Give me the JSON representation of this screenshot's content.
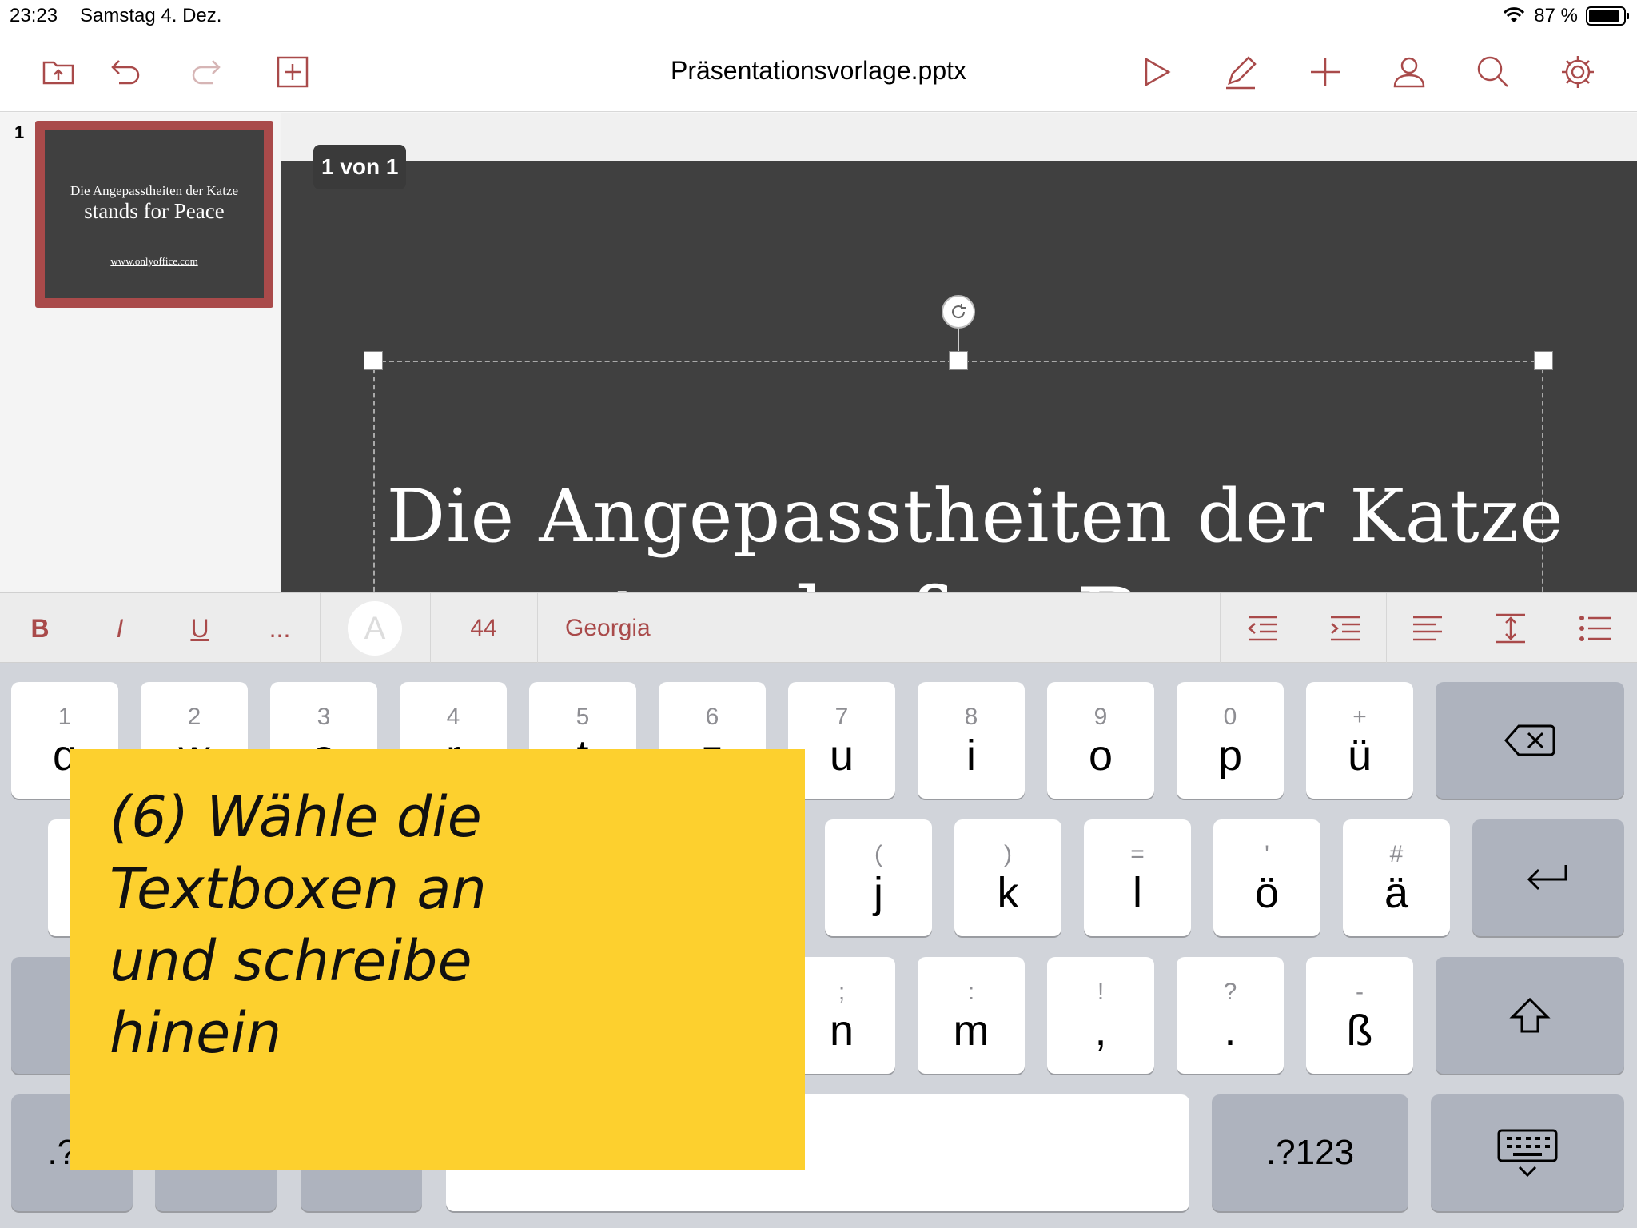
{
  "status": {
    "time": "23:23",
    "date": "Samstag 4. Dez.",
    "battery_text": "87 %",
    "battery_level": 0.87
  },
  "toolbar": {
    "title": "Präsentationsvorlage.pptx",
    "left_icons": [
      "folder-upload-icon",
      "undo-icon",
      "redo-icon",
      "add-slide-icon"
    ],
    "right_icons": [
      "play-icon",
      "edit-pen-icon",
      "add-icon",
      "user-icon",
      "search-icon",
      "settings-gear-icon"
    ]
  },
  "thumbnails": [
    {
      "number": "1",
      "line1": "Die Angepasstheiten der Katze",
      "line2": "stands for Peace",
      "url": "www.onlyoffice.com"
    }
  ],
  "slide": {
    "page_indicator": "1 von 1",
    "title": "Die Angepasstheiten der Katze",
    "subtitle_partial": "stands for Peace"
  },
  "format_bar": {
    "bold": "B",
    "italic": "I",
    "underline": "U",
    "more": "...",
    "color_letter": "A",
    "font_size": "44",
    "font_name": "Georgia"
  },
  "keyboard": {
    "row1": [
      {
        "sec": "1",
        "pri": "q"
      },
      {
        "sec": "2",
        "pri": "w"
      },
      {
        "sec": "3",
        "pri": "e"
      },
      {
        "sec": "4",
        "pri": "r"
      },
      {
        "sec": "5",
        "pri": "t"
      },
      {
        "sec": "6",
        "pri": "z"
      },
      {
        "sec": "7",
        "pri": "u"
      },
      {
        "sec": "8",
        "pri": "i"
      },
      {
        "sec": "9",
        "pri": "o"
      },
      {
        "sec": "0",
        "pri": "p"
      },
      {
        "sec": "+",
        "pri": "ü"
      }
    ],
    "row2": [
      {
        "sec": "(",
        "pri": "j"
      },
      {
        "sec": ")",
        "pri": "k"
      },
      {
        "sec": "=",
        "pri": "l"
      },
      {
        "sec": "'",
        "pri": "ö"
      },
      {
        "sec": "#",
        "pri": "ä"
      }
    ],
    "row3": [
      {
        "sec": ";",
        "pri": "n"
      },
      {
        "sec": ":",
        "pri": "m"
      },
      {
        "sec": "!",
        "pri": ","
      },
      {
        "sec": "?",
        "pri": "."
      },
      {
        "sec": "-",
        "pri": "ß"
      }
    ],
    "numbers_key": ".?123",
    "numbers_key_left": ".?1"
  },
  "sticky_note": {
    "text": "(6) Wähle die\nTextboxen an\nund schreibe\nhinein"
  },
  "colors": {
    "accent": "#a94a4a",
    "slide_bg": "#404040",
    "sticky": "#fdd02e"
  }
}
